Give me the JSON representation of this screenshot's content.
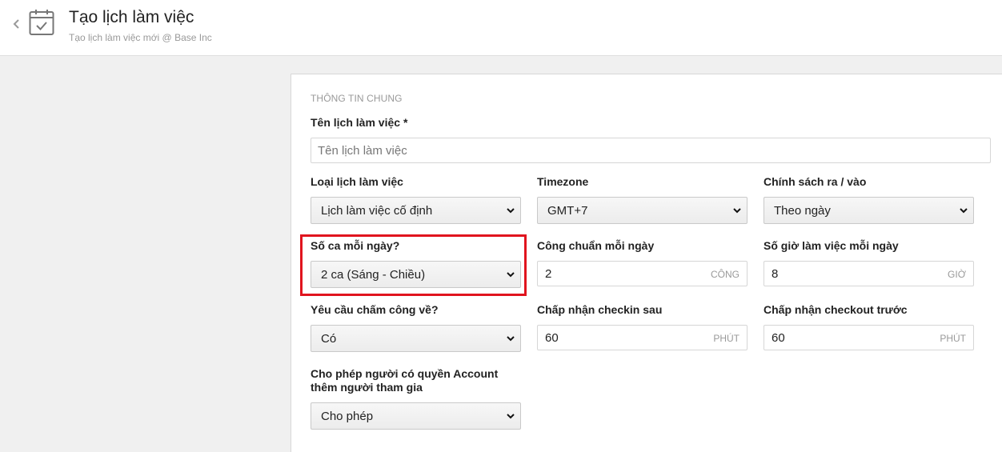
{
  "header": {
    "title": "Tạo lịch làm việc",
    "subtitle": "Tạo lịch làm việc mới @ Base Inc",
    "back_icon": "chevron-left-icon",
    "page_icon": "calendar-check-icon"
  },
  "form": {
    "section_title": "THÔNG TIN CHUNG",
    "name_field": {
      "label": "Tên lịch làm việc *",
      "placeholder": "Tên lịch làm việc",
      "value": ""
    },
    "schedule_type": {
      "label": "Loại lịch làm việc",
      "value": "Lịch làm việc cố định"
    },
    "timezone": {
      "label": "Timezone",
      "value": "GMT+7"
    },
    "checkin_policy": {
      "label": "Chính sách ra / vào",
      "value": "Theo ngày"
    },
    "shifts_per_day": {
      "label": "Số ca mỗi ngày?",
      "value": "2 ca (Sáng - Chiều)"
    },
    "standard_workday": {
      "label": "Công chuẩn mỗi ngày",
      "value": "2",
      "unit": "CÔNG"
    },
    "hours_per_day": {
      "label": "Số giờ làm việc mỗi ngày",
      "value": "8",
      "unit": "GIỜ"
    },
    "require_checkout": {
      "label": "Yêu cầu chấm công về?",
      "value": "Có"
    },
    "checkin_after": {
      "label": "Chấp nhận checkin sau",
      "value": "60",
      "unit": "PHÚT"
    },
    "checkout_before": {
      "label": "Chấp nhận checkout trước",
      "value": "60",
      "unit": "PHÚT"
    },
    "allow_add": {
      "label": "Cho phép người có quyền Account thêm người tham gia",
      "value": "Cho phép"
    }
  },
  "colors": {
    "highlight": "#e0141e",
    "background": "#f0f0f0"
  }
}
